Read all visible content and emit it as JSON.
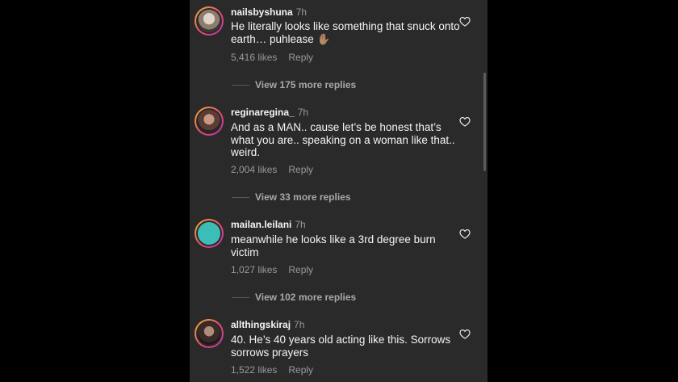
{
  "comments": [
    {
      "username": "nailsbyshuna",
      "time": "7h",
      "text": "He literally looks like something that snuck onto earth… puhlease ✋🏽",
      "likes": "5,416 likes",
      "reply_label": "Reply",
      "avatar_icon": "profile-photo",
      "view_replies": "View 175 more replies"
    },
    {
      "username": "reginaregina_",
      "time": "7h",
      "text": "And as a MAN.. cause let’s be honest that’s what you are.. speaking on a woman like that.. weird.",
      "likes": "2,004 likes",
      "reply_label": "Reply",
      "avatar_icon": "profile-photo",
      "view_replies": "View 33 more replies"
    },
    {
      "username": "mailan.leilani",
      "time": "7h",
      "text": "meanwhile he looks like a 3rd degree burn victim",
      "likes": "1,027 likes",
      "reply_label": "Reply",
      "avatar_icon": "profile-photo",
      "view_replies": "View 102 more replies"
    },
    {
      "username": "allthingskiraj",
      "time": "7h",
      "text": "40. He’s 40 years old acting like this. Sorrows sorrows prayers",
      "likes": "1,522 likes",
      "reply_label": "Reply",
      "avatar_icon": "profile-photo"
    }
  ],
  "colors": {
    "panel_bg": "#2a2a2b",
    "text": "#f5f5f5",
    "muted": "#9a9a9c",
    "story_ring": [
      "#f6b431",
      "#e64c6b",
      "#b532b0"
    ]
  },
  "icons": {
    "like": "heart-outline-icon"
  }
}
